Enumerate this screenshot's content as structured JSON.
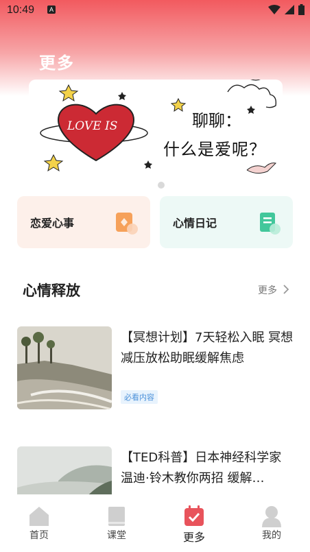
{
  "status": {
    "time": "10:49",
    "app_icon": "A"
  },
  "page": {
    "title": "更多"
  },
  "banner": {
    "line1": "聊聊：",
    "line2": "什么是爱呢？",
    "heart_text": "LOVE IS"
  },
  "cards": [
    {
      "label": "恋爱心事",
      "icon": "love-note-icon"
    },
    {
      "label": "心情日记",
      "icon": "diary-icon"
    }
  ],
  "section": {
    "title": "心情释放",
    "more": "更多"
  },
  "articles": [
    {
      "title": "【冥想计划】7天轻松入眠 冥想 减压放松助眠缓解焦虑",
      "tag": "必看内容"
    },
    {
      "title": "【TED科普】日本神经科学家温迪·铃木教你两招 缓解…",
      "tag": ""
    }
  ],
  "tabs": [
    {
      "label": "首页",
      "icon": "home-icon"
    },
    {
      "label": "课堂",
      "icon": "book-icon"
    },
    {
      "label": "更多",
      "icon": "calendar-check-icon"
    },
    {
      "label": "我的",
      "icon": "profile-icon"
    }
  ],
  "colors": {
    "accent": "#e8535b",
    "tab_inactive": "#c8c8c8"
  }
}
